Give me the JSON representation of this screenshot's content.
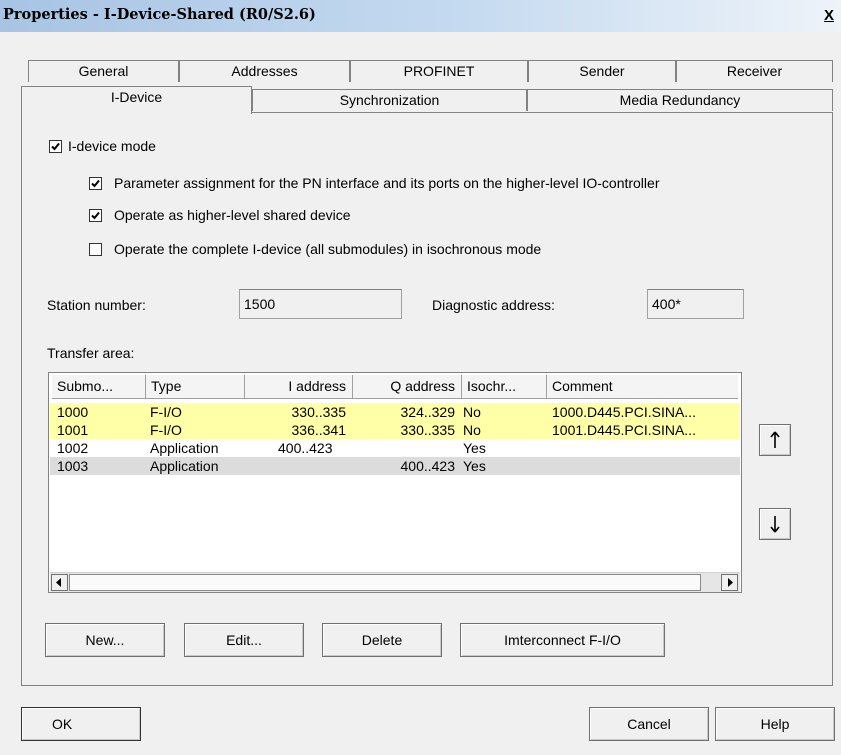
{
  "window": {
    "title": "Properties - I-Device-Shared (R0/S2.6)",
    "close_glyph": "X"
  },
  "tabs_row1": [
    "General",
    "Addresses",
    "PROFINET",
    "Sender",
    "Receiver"
  ],
  "tabs_row2": [
    "I-Device",
    "Synchronization",
    "Media Redundancy"
  ],
  "active_tab": "I-Device",
  "options": {
    "idevice_mode": {
      "label": "I-device mode",
      "checked": true
    },
    "param_assignment": {
      "label": "Parameter assignment for the PN interface and its ports on the higher-level IO-controller",
      "checked": true
    },
    "shared_device": {
      "label": "Operate as higher-level shared device",
      "checked": true
    },
    "isochronous": {
      "label": "Operate the complete I-device (all submodules) in isochronous mode",
      "checked": false
    }
  },
  "station": {
    "label": "Station number:",
    "value": "1500"
  },
  "diagnostic": {
    "label": "Diagnostic address:",
    "value": "400*"
  },
  "transfer": {
    "label": "Transfer area:",
    "columns": [
      "Submo...",
      "Type",
      "I address",
      "Q address",
      "Isochr...",
      "Comment"
    ],
    "rows": [
      {
        "submodule": "1000",
        "type": "F-I/O",
        "i_address": "330..335",
        "q_address": "324..329",
        "isochr": "No",
        "comment": "1000.D445.PCI.SINA...",
        "highlight": "#ffffa8"
      },
      {
        "submodule": "1001",
        "type": "F-I/O",
        "i_address": "336..341",
        "q_address": "330..335",
        "isochr": "No",
        "comment": "1001.D445.PCI.SINA...",
        "highlight": "#ffffa8"
      },
      {
        "submodule": "1002",
        "type": "Application",
        "i_address": "400..423",
        "q_address": "",
        "isochr": "Yes",
        "comment": "",
        "highlight": "#ffffff"
      },
      {
        "submodule": "1003",
        "type": "Application",
        "i_address": "",
        "q_address": "400..423",
        "isochr": "Yes",
        "comment": "",
        "highlight": "#dcdcdc"
      }
    ]
  },
  "buttons": {
    "new": "New...",
    "edit": "Edit...",
    "delete": "Delete",
    "interconnect": "Imterconnect F-I/O"
  },
  "footer": {
    "ok": "OK",
    "cancel": "Cancel",
    "help": "Help"
  },
  "icons": {
    "move_up": "arrow-up-icon",
    "move_down": "arrow-down-icon",
    "check": "check-icon"
  }
}
